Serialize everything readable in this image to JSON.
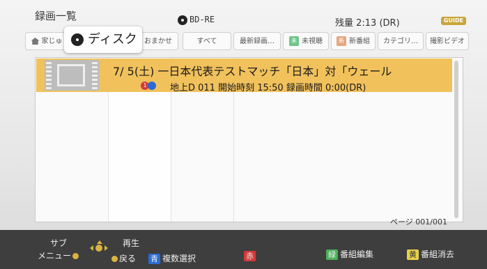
{
  "header": {
    "title": "録画一覧",
    "media": "BD-RE",
    "remaining": "残量 2:13 (DR)",
    "logo": "G GUIDE"
  },
  "tabs": [
    {
      "label": "家じゅ",
      "icon": "home-icon"
    },
    {
      "label": "おまかせ"
    },
    {
      "label": "すべて"
    },
    {
      "label": "最新録画…"
    },
    {
      "label": "未視聴",
      "badge": "未"
    },
    {
      "label": "新番組",
      "badge": "新"
    },
    {
      "label": "カテゴリ…"
    },
    {
      "label": "撮影ビデオ"
    }
  ],
  "popup": {
    "label": "ディスク"
  },
  "recording": {
    "title": "7/ 5(土) 一日本代表テストマッチ「日本」対「ウェール",
    "info": "地上D 011  開始時刻 15:50  録画時間 0:00(DR)"
  },
  "page_indicator": "ページ 001/001",
  "footer": {
    "sub_menu": "サブ",
    "menu": "メニュー",
    "play": "再生",
    "back": "戻る",
    "blue_key": "青",
    "blue_label": "複数選択",
    "red_key": "赤",
    "green_key": "緑",
    "green_label": "番組編集",
    "yellow_key": "黄",
    "yellow_label": "番組消去"
  },
  "colors": {
    "highlight": "#f1c15c",
    "blue": "#2a6ad6",
    "red": "#d43a3a",
    "green": "#4cb05a",
    "yellow": "#e8d24a"
  }
}
